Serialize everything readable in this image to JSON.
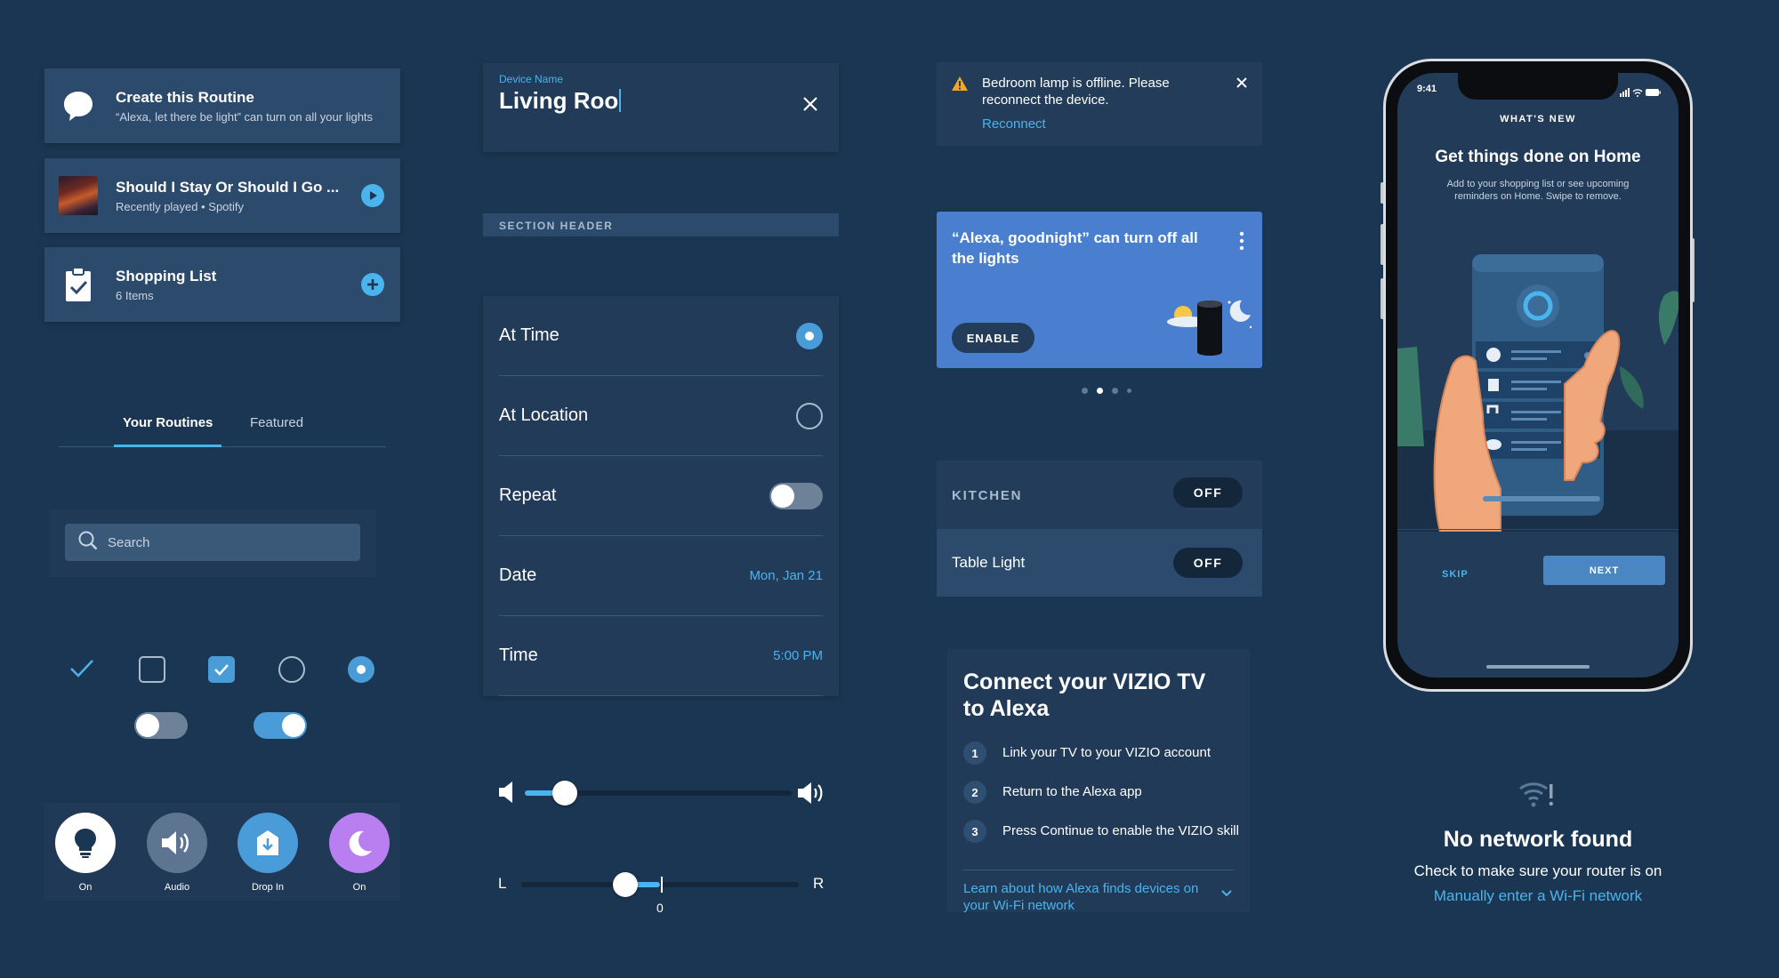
{
  "colors": {
    "background": "#1b3652",
    "card": "#2c4a6b",
    "accent": "#4ab4ee",
    "promo": "#4a7fd0",
    "warning": "#f5a623",
    "dnd_purple": "#b97ef0"
  },
  "list_cards": [
    {
      "title": "Create this Routine",
      "subtitle": "“Alexa, let there be light” can turn on all your lights",
      "lead_icon": "speech-bubble-icon"
    },
    {
      "title": "Should I Stay Or Should I Go ...",
      "subtitle": "Recently played • Spotify",
      "lead_icon": "album-art",
      "trail_icon": "play-icon"
    },
    {
      "title": "Shopping List",
      "subtitle": "6 Items",
      "lead_icon": "clipboard-check-icon",
      "trail_icon": "plus-icon"
    }
  ],
  "tabs": {
    "active": "Your Routines",
    "inactive": "Featured"
  },
  "search": {
    "placeholder": "Search"
  },
  "actions": [
    {
      "label": "On",
      "icon": "lightbulb-icon"
    },
    {
      "label": "Audio",
      "icon": "speaker-icon"
    },
    {
      "label": "Drop In",
      "icon": "drop-in-icon"
    },
    {
      "label": "On",
      "icon": "moon-icon"
    }
  ],
  "device_name": {
    "label": "Device Name",
    "value": "Living Roo"
  },
  "section_header": "SECTION HEADER",
  "settings": {
    "at_time": "At Time",
    "at_location": "At Location",
    "repeat": "Repeat",
    "date_label": "Date",
    "date_value": "Mon, Jan 21",
    "time_label": "Time",
    "time_value": "5:00 PM"
  },
  "volume_slider": {
    "value": 0.15
  },
  "balance_slider": {
    "left": "L",
    "right": "R",
    "center": "0",
    "value": -0.25
  },
  "alert": {
    "message": "Bedroom lamp is offline. Please reconnect the device.",
    "link": "Reconnect"
  },
  "promo": {
    "text": "“Alexa, goodnight” can turn off all the lights",
    "button": "ENABLE",
    "page": 2,
    "pages": 4
  },
  "kitchen": {
    "group": "KITCHEN",
    "group_state": "OFF",
    "device": "Table Light",
    "device_state": "OFF"
  },
  "connect": {
    "title": "Connect your VIZIO TV to Alexa",
    "steps": [
      {
        "n": "1",
        "text": "Link your TV to your VIZIO account"
      },
      {
        "n": "2",
        "text": "Return to the Alexa app"
      },
      {
        "n": "3",
        "text": "Press Continue to enable the VIZIO skill"
      }
    ],
    "learn": "Learn about how Alexa finds devices on your Wi-Fi network"
  },
  "phone": {
    "time": "9:41",
    "eyebrow": "WHAT'S NEW",
    "title": "Get things done on Home",
    "body": "Add to your shopping list or see upcoming reminders on Home. Swipe to remove.",
    "skip": "SKIP",
    "next": "NEXT"
  },
  "no_network": {
    "title": "No network found",
    "subtitle": "Check to make sure your router is on",
    "link": "Manually enter a Wi-Fi network"
  }
}
